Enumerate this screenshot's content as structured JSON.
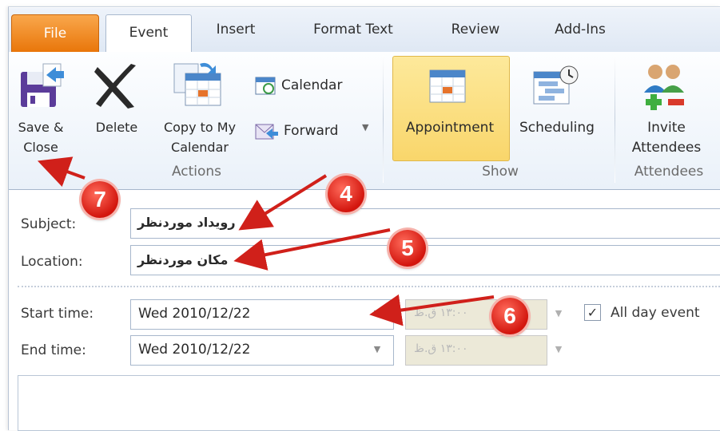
{
  "tabs": {
    "file": "File",
    "event": "Event",
    "insert": "Insert",
    "format_text": "Format Text",
    "review": "Review",
    "add_ins": "Add-Ins"
  },
  "ribbon": {
    "actions": {
      "save_close_line1": "Save &",
      "save_close_line2": "Close",
      "delete": "Delete",
      "copy_line1": "Copy to My",
      "copy_line2": "Calendar",
      "calendar": "Calendar",
      "forward": "Forward",
      "group_label": "Actions"
    },
    "show": {
      "appointment": "Appointment",
      "scheduling": "Scheduling",
      "group_label": "Show"
    },
    "attendees": {
      "invite_line1": "Invite",
      "invite_line2": "Attendees",
      "group_label": "Attendees"
    }
  },
  "form": {
    "subject_label": "Subject:",
    "subject_value": "رویداد موردنظر",
    "location_label": "Location:",
    "location_value": "مکان موردنظر",
    "start_label": "Start time:",
    "start_date": "Wed 2010/12/22",
    "start_time": "۱۳:۰۰ ق.ظ",
    "end_label": "End time:",
    "end_date": "Wed 2010/12/22",
    "end_time": "۱۳:۰۰ ق.ظ",
    "all_day_label": "All day event",
    "all_day_checked": true
  },
  "callouts": [
    "7",
    "4",
    "5",
    "6"
  ],
  "colors": {
    "file_tab": "#e9760a",
    "highlight": "#f9d66b",
    "callout": "#d3160e",
    "arrow": "#d0201a"
  }
}
